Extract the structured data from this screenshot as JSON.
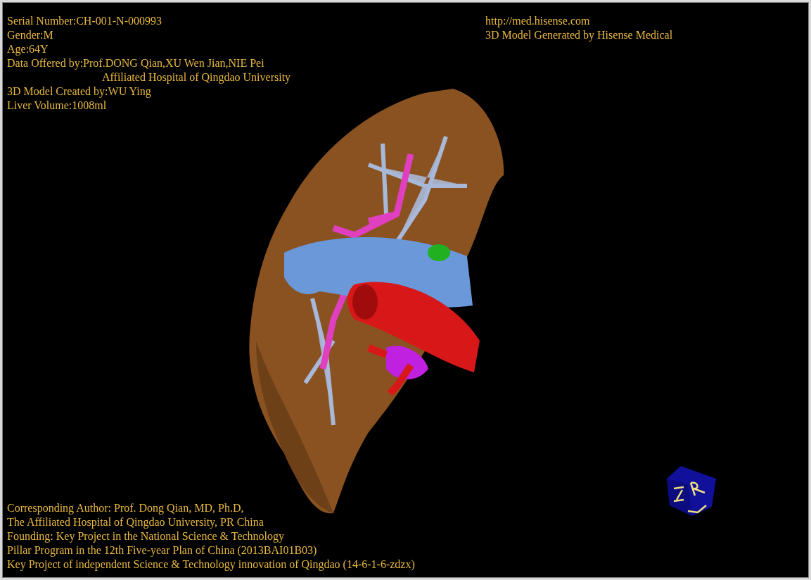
{
  "info_top_left": [
    {
      "text": "Serial Number:CH-001-N-000993",
      "kind": "plain"
    },
    {
      "text": "Gender:M",
      "kind": "plain"
    },
    {
      "text": "Age:64Y",
      "kind": "plain"
    },
    {
      "text": "Data Offered by:Prof.DONG Qian,XU Wen Jian,NIE Pei",
      "kind": "plain"
    },
    {
      "text": "Affiliated Hospital of Qingdao University",
      "kind": "indented"
    },
    {
      "text": "3D Model Created by:WU Ying",
      "kind": "plain"
    },
    {
      "text": "Liver Volume:1008ml",
      "kind": "plain"
    }
  ],
  "info_top_right": [
    "http://med.hisense.com",
    "3D Model Generated by Hisense Medical"
  ],
  "info_bottom": [
    "Corresponding Author: Prof. Dong Qian, MD, Ph.D,",
    "The Affiliated Hospital of Qingdao University, PR China",
    "Founding: Key Project in the National Science & Technology",
    "Pillar Program in the 12th Five-year Plan of China (2013BAI01B03)",
    "Key Project of independent Science & Technology innovation of Qingdao (14-6-1-6-zdzx)"
  ]
}
